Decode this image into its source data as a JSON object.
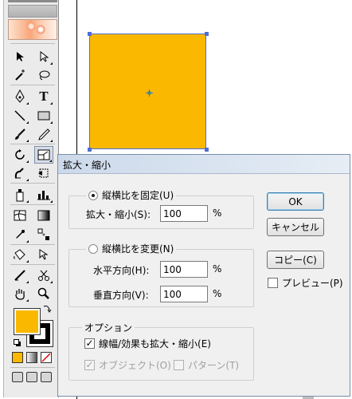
{
  "dialog": {
    "title": "拡大・縮小",
    "group_uniform": {
      "radio_label": "縦横比を固定(U)",
      "scale_label": "拡大・縮小(S):",
      "scale_value": "100",
      "unit": "%"
    },
    "group_nonuniform": {
      "radio_label": "縦横比を変更(N)",
      "horizontal_label": "水平方向(H):",
      "horizontal_value": "100",
      "vertical_label": "垂直方向(V):",
      "vertical_value": "100",
      "unit": "%"
    },
    "options": {
      "legend": "オプション",
      "scale_strokes_label": "線幅/効果も拡大・縮小(E)",
      "scale_strokes_checked": true,
      "objects_label": "オブジェクト(O)",
      "objects_checked": true,
      "patterns_label": "パターン(T)",
      "patterns_checked": false
    },
    "buttons": {
      "ok": "OK",
      "cancel": "キャンセル",
      "copy": "コピー(C)",
      "preview_label": "プレビュー(P)"
    }
  },
  "canvas": {
    "shape_fill": "#fbb800",
    "selection_color": "#4f6ed6"
  },
  "toolbox": {
    "fill_color": "#fbb800",
    "stroke_color": "#000000",
    "tool_texts": {
      "type_tool": "T"
    }
  },
  "glyphs": {
    "check": "✓"
  }
}
